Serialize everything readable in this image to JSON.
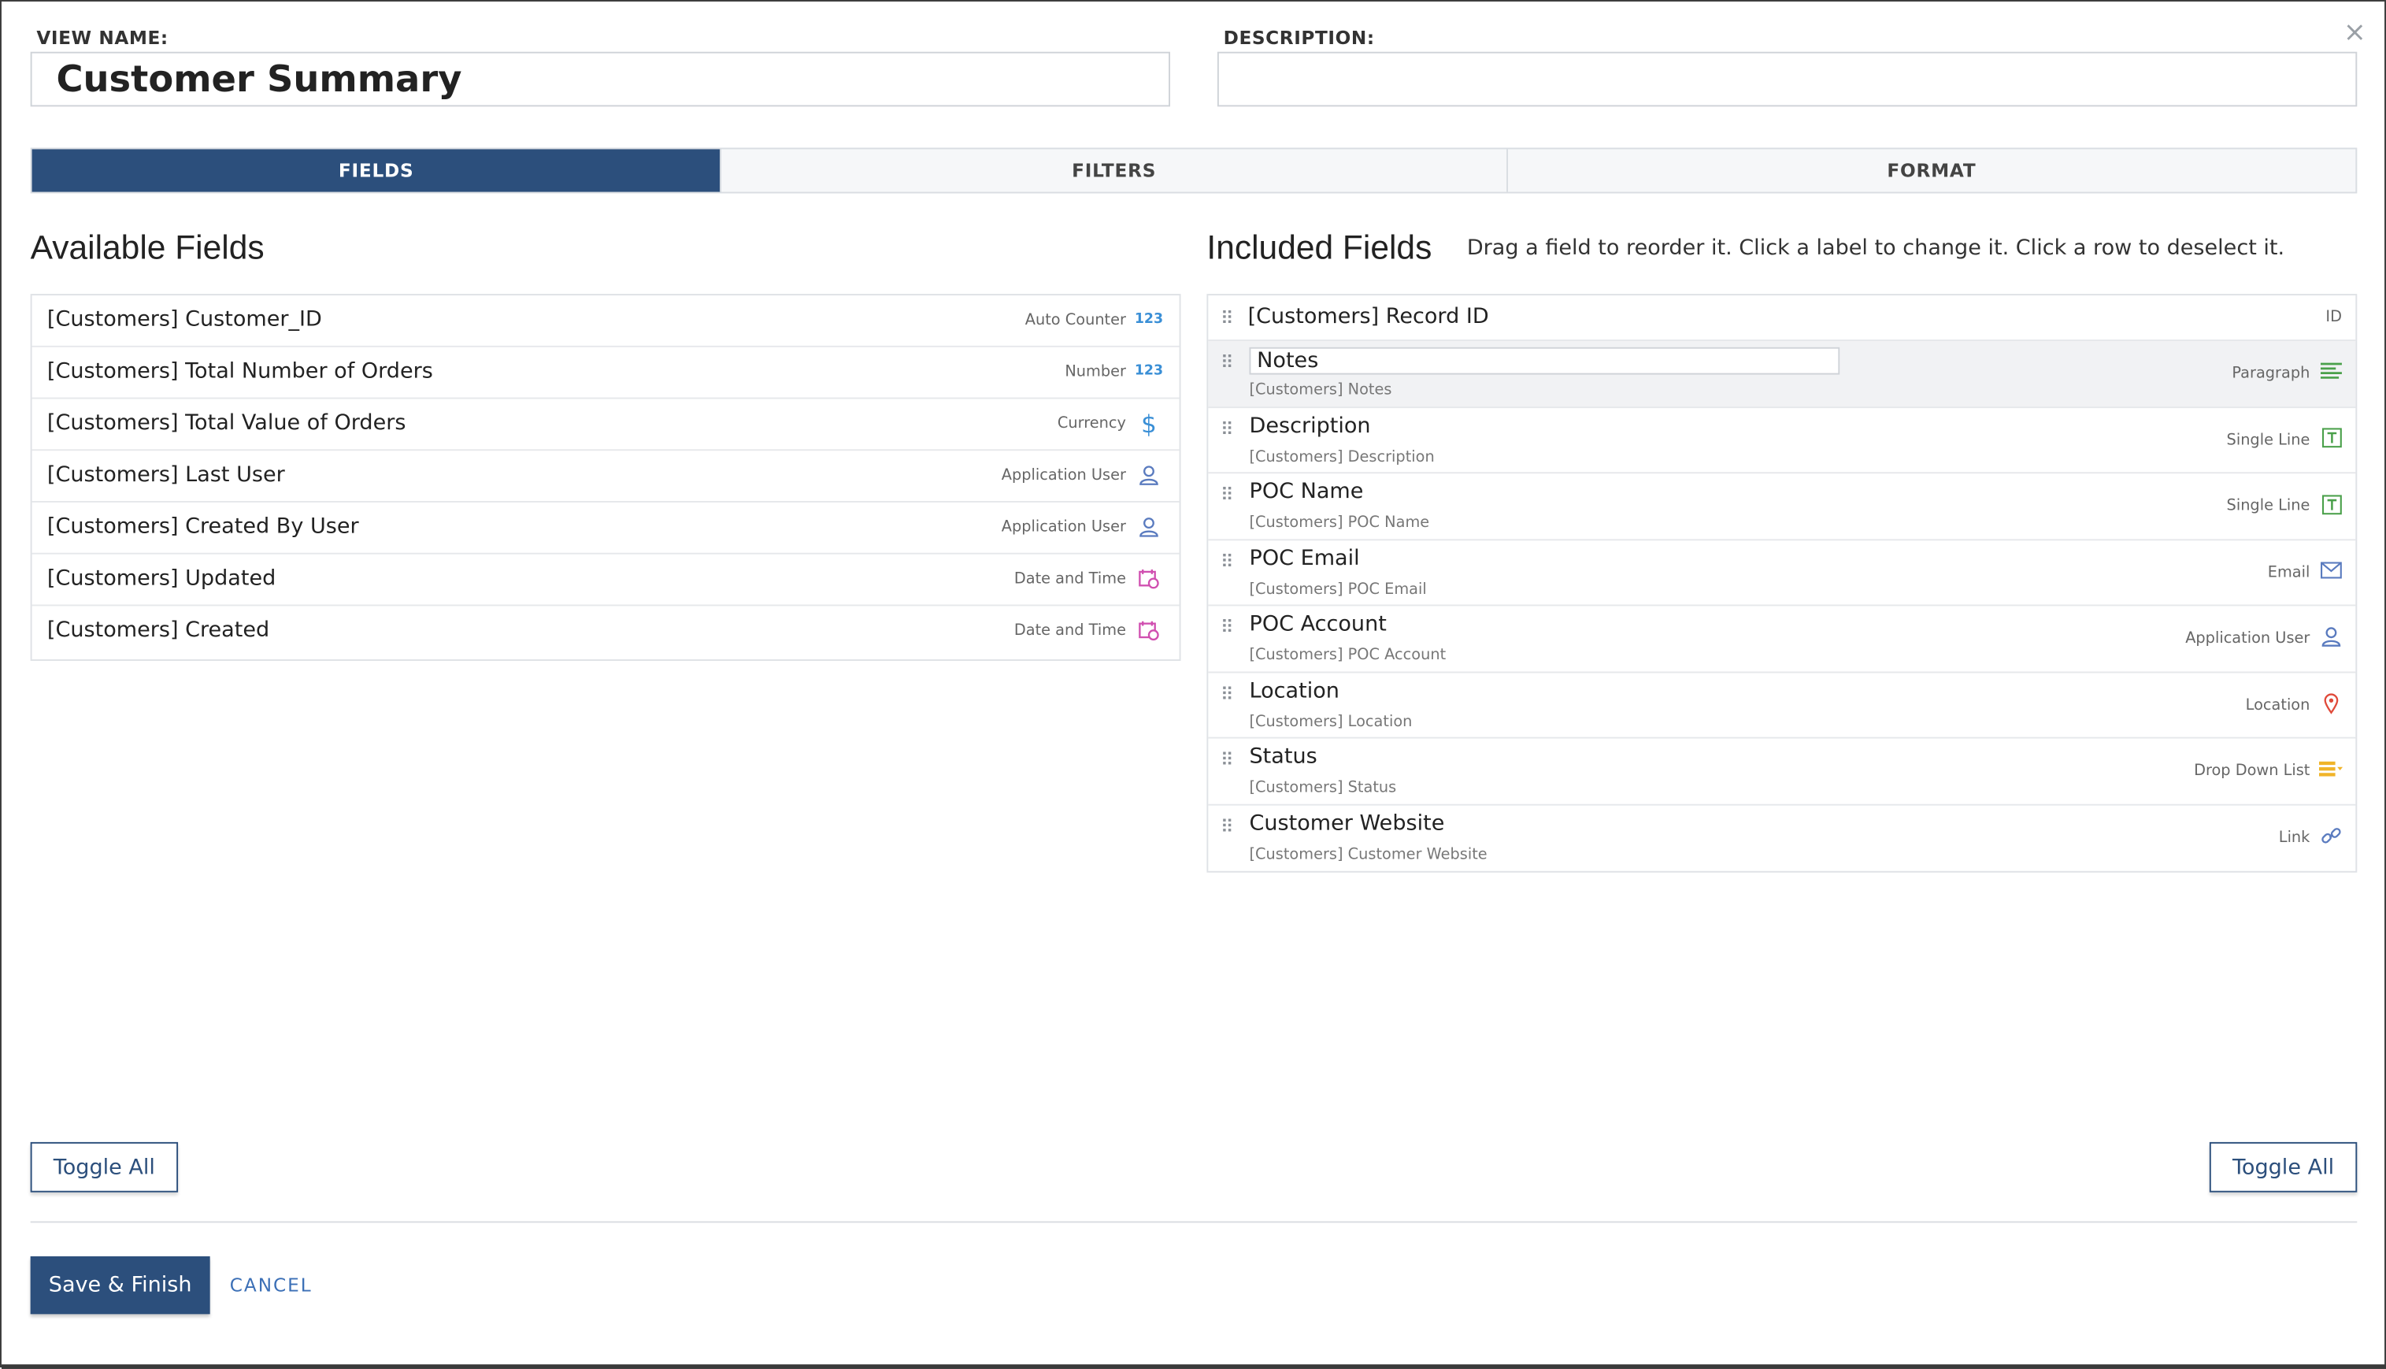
{
  "header": {
    "view_name_label": "VIEW NAME:",
    "view_name_value": "Customer Summary",
    "description_label": "DESCRIPTION:",
    "description_value": "",
    "close_symbol": "×"
  },
  "tabs": [
    {
      "label": "FIELDS",
      "active": true
    },
    {
      "label": "FILTERS",
      "active": false
    },
    {
      "label": "FORMAT",
      "active": false
    }
  ],
  "available": {
    "title": "Available Fields",
    "rows": [
      {
        "label": "[Customers] Customer_ID",
        "type": "Auto Counter",
        "icon": "number-icon",
        "glyph": "123"
      },
      {
        "label": "[Customers] Total Number of Orders",
        "type": "Number",
        "icon": "number-icon",
        "glyph": "123"
      },
      {
        "label": "[Customers] Total Value of Orders",
        "type": "Currency",
        "icon": "dollar-icon",
        "glyph": "$"
      },
      {
        "label": "[Customers] Last User",
        "type": "Application User",
        "icon": "user-icon",
        "glyph": "user"
      },
      {
        "label": "[Customers] Created By User",
        "type": "Application User",
        "icon": "user-icon",
        "glyph": "user"
      },
      {
        "label": "[Customers] Updated",
        "type": "Date and Time",
        "icon": "calendar-clock-icon",
        "glyph": "cal"
      },
      {
        "label": "[Customers] Created",
        "type": "Date and Time",
        "icon": "calendar-clock-icon",
        "glyph": "cal"
      }
    ],
    "toggle_label": "Toggle All"
  },
  "included": {
    "title": "Included Fields",
    "instructions": "Drag a field to reorder it. Click a label to change it. Click a row to deselect it.",
    "rows": [
      {
        "label": "[Customers] Record ID",
        "sub": "",
        "type": "ID",
        "icon": "",
        "glyph": ""
      },
      {
        "label": "Notes",
        "sub": "[Customers] Notes",
        "type": "Paragraph",
        "icon": "paragraph-icon",
        "glyph": "para",
        "editing": true
      },
      {
        "label": "Description",
        "sub": "[Customers] Description",
        "type": "Single Line",
        "icon": "text-field-icon",
        "glyph": "T"
      },
      {
        "label": "POC Name",
        "sub": "[Customers] POC Name",
        "type": "Single Line",
        "icon": "text-field-icon",
        "glyph": "T"
      },
      {
        "label": "POC Email",
        "sub": "[Customers] POC Email",
        "type": "Email",
        "icon": "envelope-icon",
        "glyph": "mail"
      },
      {
        "label": "POC Account",
        "sub": "[Customers] POC Account",
        "type": "Application User",
        "icon": "user-icon",
        "glyph": "user"
      },
      {
        "label": "Location",
        "sub": "[Customers] Location",
        "type": "Location",
        "icon": "map-pin-icon",
        "glyph": "pin"
      },
      {
        "label": "Status",
        "sub": "[Customers] Status",
        "type": "Drop Down List",
        "icon": "dropdown-list-icon",
        "glyph": "ddl"
      },
      {
        "label": "Customer Website",
        "sub": "[Customers] Customer Website",
        "type": "Link",
        "icon": "link-icon",
        "glyph": "link"
      }
    ],
    "toggle_label": "Toggle All"
  },
  "footer": {
    "save_label": "Save & Finish",
    "cancel_label": "CANCEL"
  },
  "colors": {
    "accent": "#2c4f7c",
    "link": "#3b6fb6",
    "number_icon": "#3a8fd6",
    "calendar_icon": "#d04fb0",
    "text_icon": "#4aa04a",
    "paragraph_icon": "#4aa04a",
    "user_icon": "#5a7bbf",
    "pin_icon": "#e04a3a",
    "dropdown_icon": "#f0b429"
  }
}
